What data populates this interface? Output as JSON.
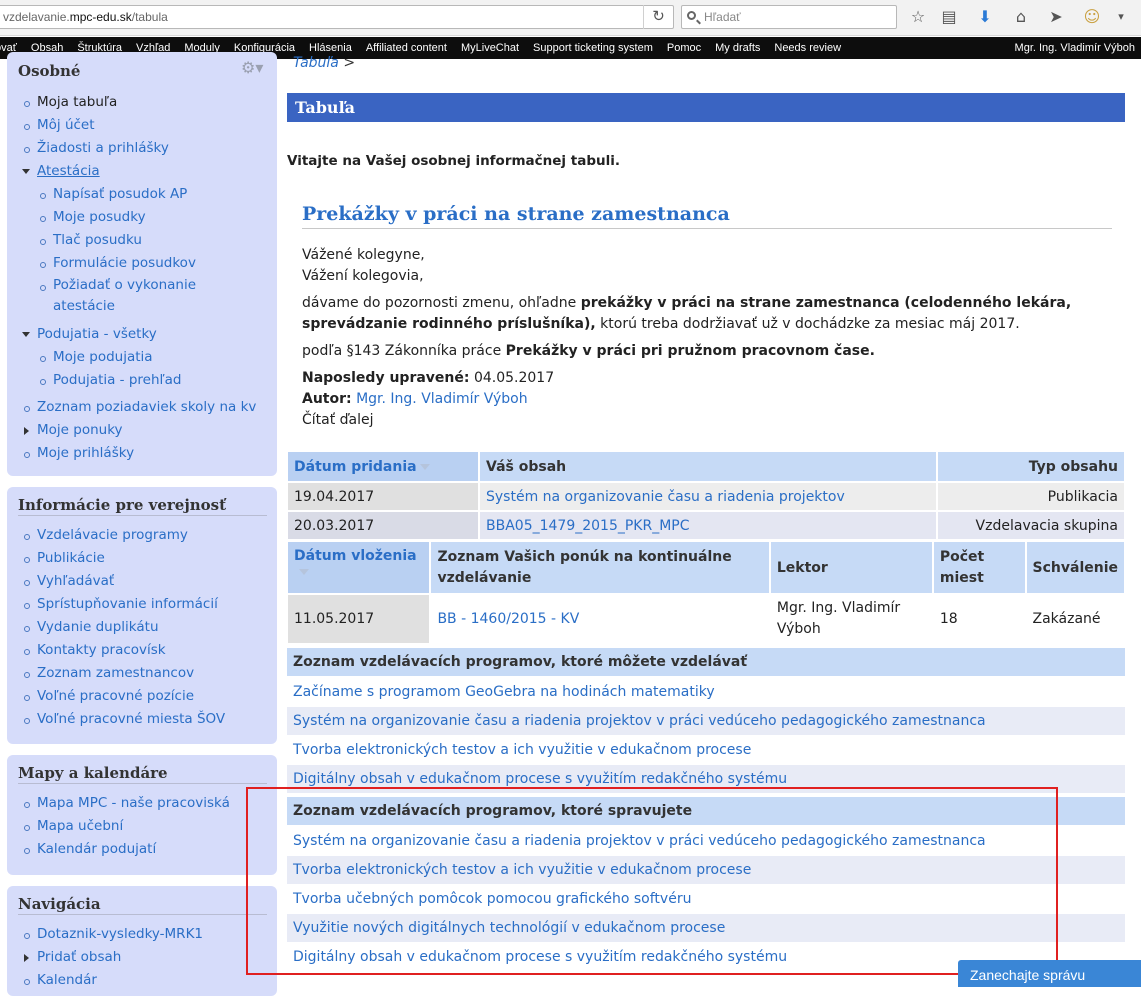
{
  "browser": {
    "url_prefix": "vzdelavanie.",
    "url_domain": "mpc-edu.sk",
    "url_path": "/tabula",
    "search_placeholder": "Hľadať"
  },
  "admin_toolbar": {
    "items": [
      "tovať",
      "Obsah",
      "Štruktúra",
      "Vzhľad",
      "Moduly",
      "Konfigurácia",
      "Hlásenia",
      "Affiliated content",
      "MyLiveChat",
      "Support ticketing system",
      "Pomoc",
      "My drafts",
      "Needs review"
    ],
    "user": "Mgr. Ing. Vladimír Výboh"
  },
  "sidebar": {
    "personal": {
      "title": "Osobné",
      "items": [
        "Moja tabuľa",
        "Môj účet",
        "Žiadosti a prihlášky",
        "Atestácia",
        "Napísať posudok AP",
        "Moje posudky",
        "Tlač posudku",
        "Formulácie posudkov",
        "Požiadať o vykonanie",
        "atestácie",
        "Podujatia - všetky",
        "Moje podujatia",
        "Podujatia - prehľad",
        "Zoznam poziadaviek skoly na kv",
        "Moje ponuky",
        "Moje prihlášky"
      ]
    },
    "public_info": {
      "title": "Informácie pre verejnosť",
      "items": [
        "Vzdelávacie programy",
        "Publikácie",
        "Vyhľadávať",
        "Sprístupňovanie informácií",
        "Vydanie duplikátu",
        "Kontakty pracovísk",
        "Zoznam zamestnancov",
        "Voľné pracovné pozície",
        "Voľné pracovné miesta ŠOV"
      ]
    },
    "maps": {
      "title": "Mapy a kalendáre",
      "items": [
        "Mapa MPC - naše pracoviská",
        "Mapa učební",
        "Kalendár podujatí"
      ]
    },
    "navigation": {
      "title": "Navigácia",
      "items": [
        "Dotaznik-vysledky-MRK1",
        "Pridať obsah",
        "Kalendár"
      ]
    }
  },
  "main": {
    "breadcrumb": "Tabuľa",
    "breadcrumb_sep": ">",
    "page_title": "Tabuľa",
    "welcome": "Vitajte na Vašej osobnej informačnej tabuli.",
    "article": {
      "title": "Prekážky v práci na strane zamestnanca",
      "greeting1": "Vážené kolegyne,",
      "greeting2": "Vážení kolegovia,",
      "body_start": "dávame do pozornosti zmenu, ohľadne ",
      "body_bold": "prekážky v práci na strane zamestnanca (celodenného lekára, sprevádzanie rodinného príslušníka),",
      "body_end": " ktorú treba dodržiavať už v dochádzke za mesiac máj 2017.",
      "law_start": "podľa §143 Zákonníka práce ",
      "law_bold": "Prekážky v práci pri pružnom pracovnom čase.",
      "updated_label": "Naposledy upravené:",
      "updated_value": "04.05.2017",
      "author_label": "Autor:",
      "author_value": "Mgr. Ing. Vladimír Výboh",
      "read_more": "Čítať ďalej"
    },
    "content_table": {
      "headers": [
        "Dátum pridania",
        "Váš obsah",
        "Typ obsahu"
      ],
      "rows": [
        {
          "date": "19.04.2017",
          "title": "Systém na organizovanie času a riadenia projektov",
          "type": "Publikacia"
        },
        {
          "date": "20.03.2017",
          "title": "BBA05_1479_2015_PKR_MPC",
          "type": "Vzdelavacia skupina"
        }
      ]
    },
    "offers_table": {
      "headers": [
        "Dátum vloženia",
        "Zoznam Vašich ponúk na kontinuálne vzdelávanie",
        "Lektor",
        "Počet miest",
        "Schválenie"
      ],
      "rows": [
        {
          "date": "11.05.2017",
          "title": "BB - 1460/2015 - KV",
          "lector": "Mgr. Ing. Vladimír Výboh",
          "seats": "18",
          "approval": "Zakázané"
        }
      ]
    },
    "programs_can_teach": {
      "title": "Zoznam vzdelávacích programov, ktoré môžete vzdelávať",
      "items": [
        "Začíname s programom GeoGebra na hodinách matematiky",
        "Systém na organizovanie času a riadenia projektov v práci vedúceho pedagogického zamestnanca",
        "Tvorba elektronických testov a ich využitie v edukačnom procese",
        "Digitálny obsah v edukačnom procese s využitím redakčného systému"
      ]
    },
    "programs_managed": {
      "title": "Zoznam vzdelávacích programov, ktoré spravujete",
      "items": [
        "Systém na organizovanie času a riadenia projektov v práci vedúceho pedagogického zamestnanca",
        "Tvorba elektronických testov a ich využitie v edukačnom procese",
        "Tvorba učebných pomôcok pomocou grafického softvéru",
        "Využitie nových digitálnych technológií v edukačnom procese",
        "Digitálny obsah v edukačnom procese s využitím redakčného systému"
      ]
    }
  },
  "chat": {
    "label": "Zanechajte správu"
  },
  "colors": {
    "title_bar": "#3a64c2",
    "link": "#2a6ec6",
    "sidebar_bg": "#d6dcfa",
    "table_header": "#c6daf6",
    "highlight_box": "#e02020"
  }
}
